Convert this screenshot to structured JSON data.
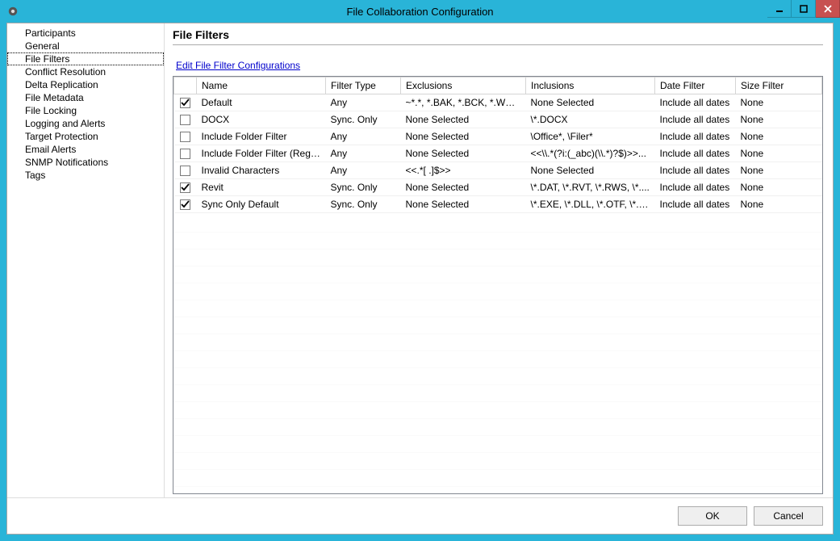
{
  "window": {
    "title": "File Collaboration Configuration"
  },
  "sidebar": {
    "items": [
      {
        "label": "Participants"
      },
      {
        "label": "General"
      },
      {
        "label": "File Filters",
        "selected": true
      },
      {
        "label": "Conflict Resolution"
      },
      {
        "label": "Delta Replication"
      },
      {
        "label": "File Metadata"
      },
      {
        "label": "File Locking"
      },
      {
        "label": "Logging and Alerts"
      },
      {
        "label": "Target Protection"
      },
      {
        "label": "Email Alerts"
      },
      {
        "label": "SNMP Notifications"
      },
      {
        "label": "Tags"
      }
    ]
  },
  "main": {
    "page_title": "File Filters",
    "edit_link": "Edit File Filter Configurations",
    "columns": {
      "name": "Name",
      "filter_type": "Filter Type",
      "exclusions": "Exclusions",
      "inclusions": "Inclusions",
      "date_filter": "Date Filter",
      "size_filter": "Size Filter"
    },
    "rows": [
      {
        "checked": true,
        "name": "Default",
        "filter_type": "Any",
        "exclusions": "~*.*, *.BAK, *.BCK, *.WBK, ...",
        "inclusions": "None Selected",
        "date_filter": "Include all dates",
        "size_filter": "None"
      },
      {
        "checked": false,
        "name": "DOCX",
        "filter_type": "Sync. Only",
        "exclusions": "None Selected",
        "inclusions": "\\*.DOCX",
        "date_filter": "Include all dates",
        "size_filter": "None"
      },
      {
        "checked": false,
        "name": "Include Folder Filter",
        "filter_type": "Any",
        "exclusions": "None Selected",
        "inclusions": "\\Office*, \\Filer*",
        "date_filter": "Include all dates",
        "size_filter": "None"
      },
      {
        "checked": false,
        "name": "Include Folder Filter (Regex)",
        "filter_type": "Any",
        "exclusions": "None Selected",
        "inclusions": "<<\\\\.*(?i:(_abc)(\\\\.*)?$)>>...",
        "date_filter": "Include all dates",
        "size_filter": "None"
      },
      {
        "checked": false,
        "name": "Invalid Characters",
        "filter_type": "Any",
        "exclusions": "<<.*[ .]$>>",
        "inclusions": "None Selected",
        "date_filter": "Include all dates",
        "size_filter": "None"
      },
      {
        "checked": true,
        "name": "Revit",
        "filter_type": "Sync. Only",
        "exclusions": "None Selected",
        "inclusions": "\\*.DAT, \\*.RVT, \\*.RWS, \\*....",
        "date_filter": "Include all dates",
        "size_filter": "None"
      },
      {
        "checked": true,
        "name": "Sync Only Default",
        "filter_type": "Sync. Only",
        "exclusions": "None Selected",
        "inclusions": "\\*.EXE, \\*.DLL, \\*.OTF, \\*.T...",
        "date_filter": "Include all dates",
        "size_filter": "None"
      }
    ]
  },
  "footer": {
    "ok": "OK",
    "cancel": "Cancel"
  }
}
